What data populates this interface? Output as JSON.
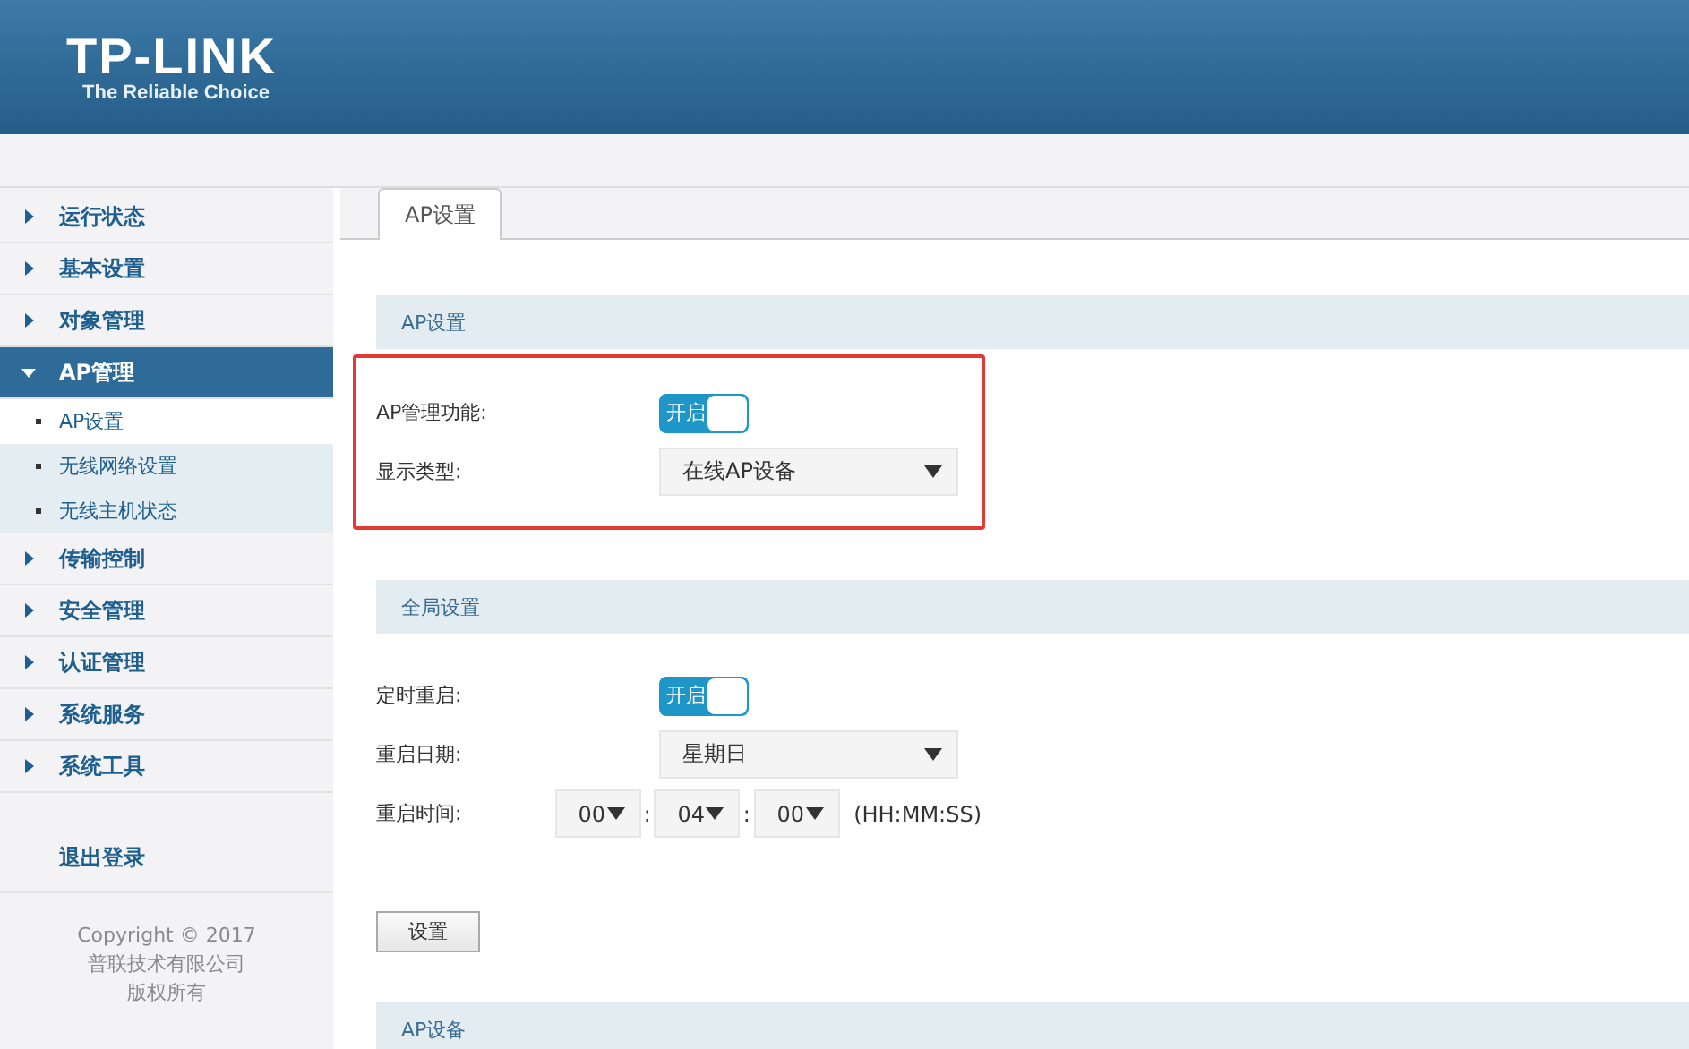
{
  "header": {
    "logo": "TP-LINK",
    "tagline": "The Reliable Choice"
  },
  "sidebar": {
    "items": [
      {
        "label": "运行状态",
        "expanded": false
      },
      {
        "label": "基本设置",
        "expanded": false
      },
      {
        "label": "对象管理",
        "expanded": false
      },
      {
        "label": "AP管理",
        "expanded": true,
        "children": [
          {
            "label": "AP设置",
            "selected": true
          },
          {
            "label": "无线网络设置",
            "selected": false
          },
          {
            "label": "无线主机状态",
            "selected": false
          }
        ]
      },
      {
        "label": "传输控制",
        "expanded": false
      },
      {
        "label": "安全管理",
        "expanded": false
      },
      {
        "label": "认证管理",
        "expanded": false
      },
      {
        "label": "系统服务",
        "expanded": false
      },
      {
        "label": "系统工具",
        "expanded": false
      }
    ],
    "logout": "退出登录",
    "copyright": [
      "Copyright © 2017",
      "普联技术有限公司",
      "版权所有"
    ]
  },
  "tabs": [
    {
      "label": "AP设置",
      "selected": true
    }
  ],
  "sections": [
    {
      "title": "AP设置",
      "highlighted": true,
      "rows": [
        {
          "kind": "toggle",
          "label": "AP管理功能:",
          "on": true,
          "state_text": "开启"
        },
        {
          "kind": "select",
          "label": "显示类型:",
          "value": "在线AP设备"
        }
      ]
    },
    {
      "title": "全局设置",
      "highlighted": false,
      "rows": [
        {
          "kind": "toggle",
          "label": "定时重启:",
          "on": true,
          "state_text": "开启"
        },
        {
          "kind": "select",
          "label": "重启日期:",
          "value": "星期日"
        },
        {
          "kind": "time",
          "label": "重启时间:",
          "values": [
            "00",
            "04",
            "00"
          ],
          "separator": ":",
          "hint": "(HH:MM:SS)"
        }
      ],
      "button": "设置"
    },
    {
      "title": "AP设备",
      "highlighted": false
    }
  ]
}
